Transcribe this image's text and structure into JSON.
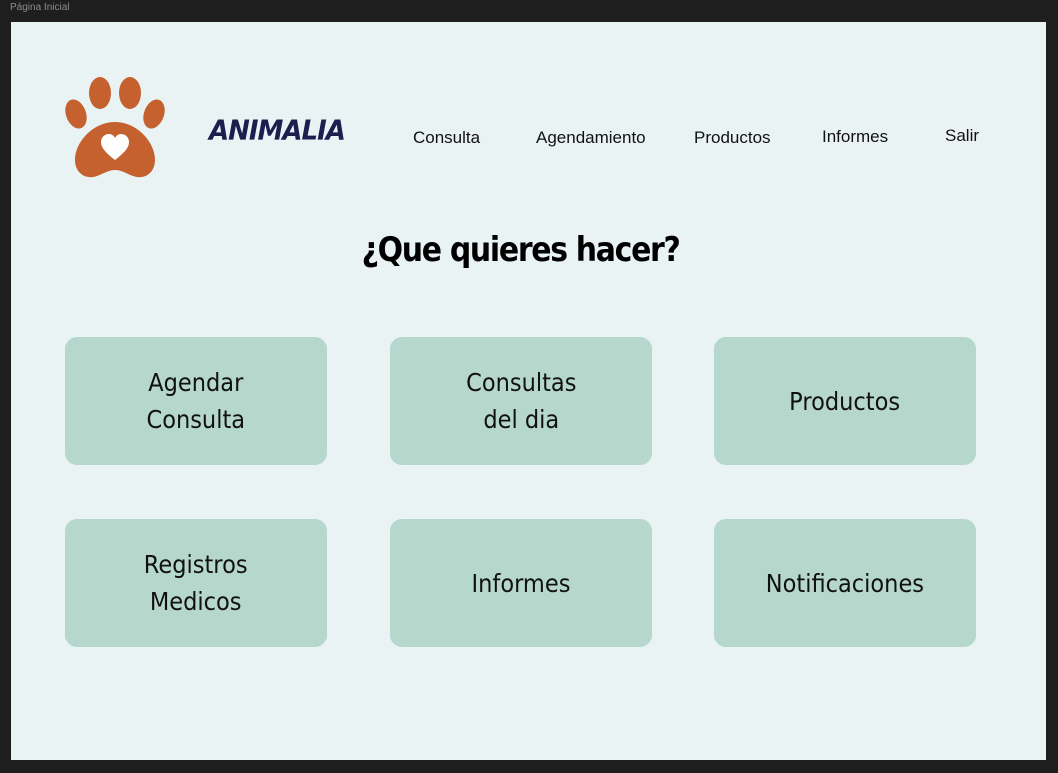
{
  "frame": {
    "label": "Página Inicial"
  },
  "header": {
    "brand": "ANIMALIA",
    "nav": [
      "Consulta",
      "Agendamiento",
      "Productos",
      "Informes",
      "Salir"
    ]
  },
  "main": {
    "heading": "¿Que quieres hacer?",
    "cards": [
      "Agendar\nConsulta",
      "Consultas\ndel dia",
      "Productos",
      "Registros\nMedicos",
      "Informes",
      "Notificaciones"
    ]
  },
  "colors": {
    "background": "#eaf3f4",
    "card": "#b5d7cc",
    "paw": "#c5602f",
    "brand": "#1a1f4f"
  },
  "icons": {
    "logo": "paw-heart-icon"
  }
}
